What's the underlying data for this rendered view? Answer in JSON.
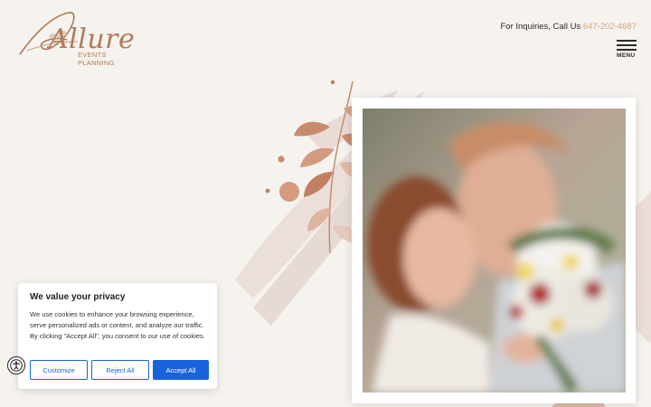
{
  "brand": {
    "name": "Allure",
    "tagline": "EVENTS PLANNING",
    "color": "#b07a5a"
  },
  "header": {
    "inquiries_label": "For Inquiries, Call Us",
    "phone": "647-202-4687",
    "phone_color": "#d2a387",
    "menu_label": "MENU",
    "menu_icon": "hamburger-icon"
  },
  "hero": {
    "image": "bride-and-groom-with-bouquet-photo",
    "decor": "watercolor-leaves-and-brush-strokes"
  },
  "cookie_banner": {
    "title": "We value your privacy",
    "body": "We use cookies to enhance your browsing experience, serve personalized ads or content, and analyze our traffic. By clicking \"Accept All\", you consent to our use of cookies.",
    "customize_label": "Customize",
    "reject_label": "Reject All",
    "accept_label": "Accept All",
    "accent": "#1863dc"
  },
  "accessibility": {
    "icon": "accessibility-icon"
  }
}
